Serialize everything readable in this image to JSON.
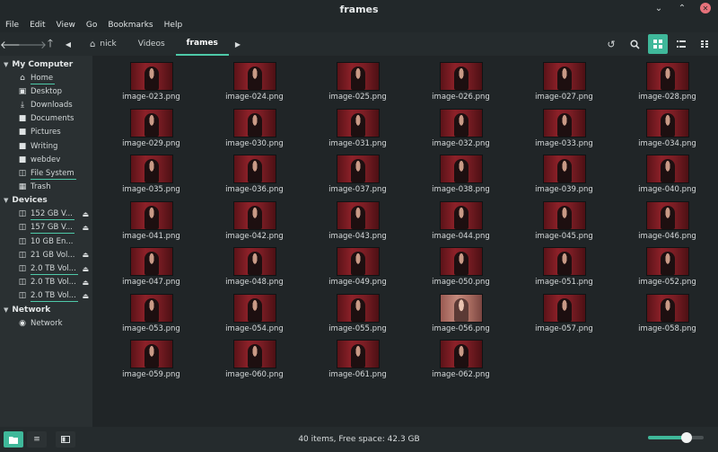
{
  "window": {
    "title": "frames"
  },
  "menu": [
    "File",
    "Edit",
    "View",
    "Go",
    "Bookmarks",
    "Help"
  ],
  "breadcrumb": [
    "nick",
    "Videos",
    "frames"
  ],
  "sidebar": {
    "my_computer": {
      "title": "My Computer",
      "items": [
        {
          "label": "Home",
          "icon": "home-icon"
        },
        {
          "label": "Desktop",
          "icon": "desktop-icon"
        },
        {
          "label": "Downloads",
          "icon": "download-icon"
        },
        {
          "label": "Documents",
          "icon": "folder-icon"
        },
        {
          "label": "Pictures",
          "icon": "folder-icon"
        },
        {
          "label": "Writing",
          "icon": "folder-icon"
        },
        {
          "label": "webdev",
          "icon": "folder-icon"
        },
        {
          "label": "File System",
          "icon": "drive-icon"
        },
        {
          "label": "Trash",
          "icon": "trash-icon"
        }
      ]
    },
    "devices": {
      "title": "Devices",
      "items": [
        {
          "label": "152 GB V..."
        },
        {
          "label": "157 GB V..."
        },
        {
          "label": "10 GB En..."
        },
        {
          "label": "21 GB Vol..."
        },
        {
          "label": "2.0 TB Vol..."
        },
        {
          "label": "2.0 TB Vol..."
        },
        {
          "label": "2.0 TB Vol..."
        }
      ]
    },
    "network": {
      "title": "Network",
      "items": [
        {
          "label": "Network"
        }
      ]
    }
  },
  "files": [
    "image-023.png",
    "image-024.png",
    "image-025.png",
    "image-026.png",
    "image-027.png",
    "image-028.png",
    "image-029.png",
    "image-030.png",
    "image-031.png",
    "image-032.png",
    "image-033.png",
    "image-034.png",
    "image-035.png",
    "image-036.png",
    "image-037.png",
    "image-038.png",
    "image-039.png",
    "image-040.png",
    "image-041.png",
    "image-042.png",
    "image-043.png",
    "image-044.png",
    "image-045.png",
    "image-046.png",
    "image-047.png",
    "image-048.png",
    "image-049.png",
    "image-050.png",
    "image-051.png",
    "image-052.png",
    "image-053.png",
    "image-054.png",
    "image-055.png",
    "image-056.png",
    "image-057.png",
    "image-058.png",
    "image-059.png",
    "image-060.png",
    "image-061.png",
    "image-062.png"
  ],
  "status": {
    "text": "40 items, Free space: 42.3 GB",
    "zoom_fraction": 0.7
  },
  "colors": {
    "accent": "#3fb89a",
    "close": "#e7727b"
  }
}
